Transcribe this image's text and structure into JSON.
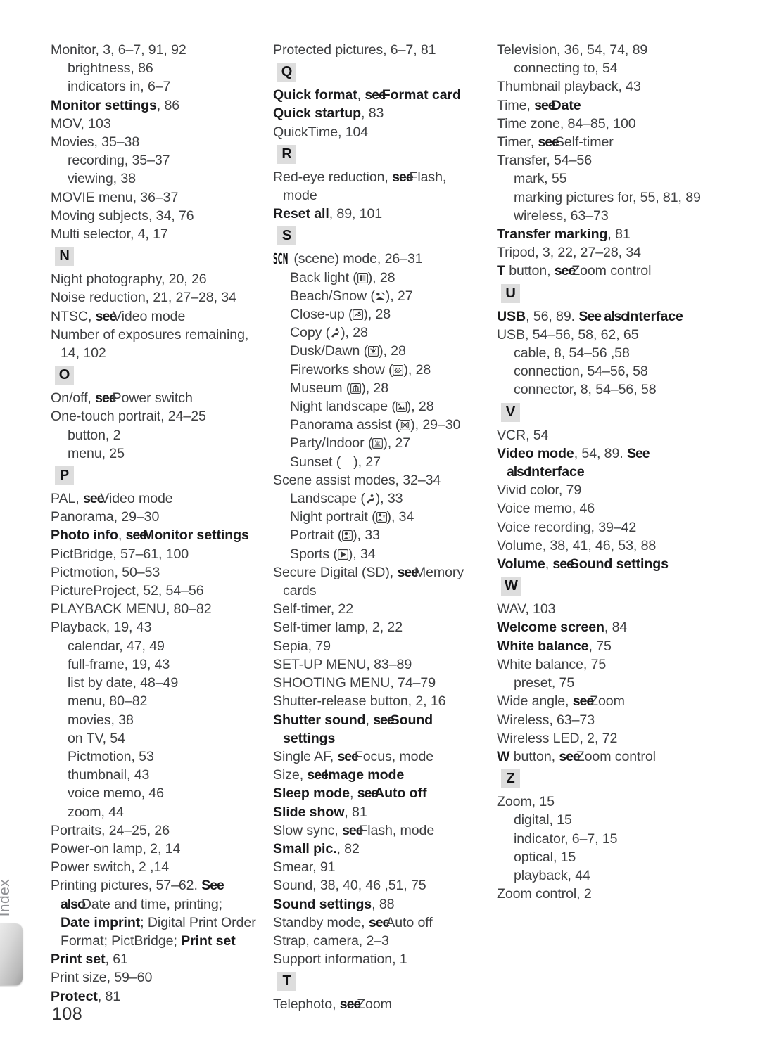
{
  "page": {
    "folio": "108",
    "tab_label": "Index"
  },
  "columns": [
    {
      "id": "column-1",
      "entries": [
        {
          "level": 1,
          "text": "Monitor, 3, 6–7, 91, 92"
        },
        {
          "level": 2,
          "text": "brightness, 86"
        },
        {
          "level": 2,
          "text": "indicators in, 6–7"
        },
        {
          "level": 1,
          "bold_head": "Monitor settings",
          "text": ", 86"
        },
        {
          "level": 1,
          "text": "MOV, 103"
        },
        {
          "level": 1,
          "text": "Movies, 35–38"
        },
        {
          "level": 2,
          "text": "recording, 35–37"
        },
        {
          "level": 2,
          "text": "viewing, 38"
        },
        {
          "level": 1,
          "text": "MOVIE menu, 36–37"
        },
        {
          "level": 1,
          "text": "Moving subjects, 34, 76"
        },
        {
          "level": 1,
          "text": "Multi selector, 4, 17"
        },
        {
          "letter": "N"
        },
        {
          "level": 1,
          "text": "Night photography, 20, 26"
        },
        {
          "level": 1,
          "text": "Noise reduction, 21, 27–28, 34"
        },
        {
          "level": 1,
          "pre": "NTSC, ",
          "see": "see",
          "post": "Video mode"
        },
        {
          "level": 1,
          "text": "Number of exposures remaining,"
        },
        {
          "level": 3,
          "text": "14, 102"
        },
        {
          "letter": "O"
        },
        {
          "level": 1,
          "pre": "On/off, ",
          "see": "see",
          "post": "Power switch"
        },
        {
          "level": 1,
          "text": "One-touch portrait, 24–25"
        },
        {
          "level": 2,
          "text": "button, 2"
        },
        {
          "level": 2,
          "text": "menu, 25"
        },
        {
          "letter": "P"
        },
        {
          "level": 1,
          "pre": "PAL, ",
          "see": "see",
          "post": "Video mode"
        },
        {
          "level": 1,
          "text": "Panorama, 29–30"
        },
        {
          "level": 1,
          "bold_head": "Photo info",
          "pre": ", ",
          "see": "see",
          "bold_post": "Monitor settings"
        },
        {
          "level": 1,
          "text": "PictBridge, 57–61, 100"
        },
        {
          "level": 1,
          "text": "Pictmotion, 50–53"
        },
        {
          "level": 1,
          "text": "PictureProject, 52, 54–56"
        },
        {
          "level": 1,
          "text": "PLAYBACK MENU, 80–82"
        },
        {
          "level": 1,
          "text": "Playback, 19, 43"
        },
        {
          "level": 2,
          "text": "calendar, 47, 49"
        },
        {
          "level": 2,
          "text": "full-frame, 19, 43"
        },
        {
          "level": 2,
          "text": "list by date, 48–49"
        },
        {
          "level": 2,
          "text": "menu, 80–82"
        },
        {
          "level": 2,
          "text": "movies, 38"
        },
        {
          "level": 2,
          "text": "on TV, 54"
        },
        {
          "level": 2,
          "text": "Pictmotion, 53"
        },
        {
          "level": 2,
          "text": "thumbnail, 43"
        },
        {
          "level": 2,
          "text": "voice memo, 46"
        },
        {
          "level": 2,
          "text": "zoom, 44"
        },
        {
          "level": 1,
          "text": "Portraits, 24–25, 26"
        },
        {
          "level": 1,
          "text": "Power-on lamp, 2, 14"
        },
        {
          "level": 1,
          "text": "Power switch, 2 ,14"
        },
        {
          "level": 1,
          "pre": "Printing pictures, 57–62. ",
          "see": "See"
        },
        {
          "level": 3,
          "see": "also",
          "post": "Date and time, printing;"
        },
        {
          "level": 3,
          "bold_head": "Date imprint",
          "post": "; Digital Print Order"
        },
        {
          "level": 3,
          "pre": "Format; PictBridge; ",
          "bold_tail": "Print set"
        },
        {
          "level": 1,
          "bold_head": "Print set",
          "text": ", 61"
        },
        {
          "level": 1,
          "text": "Print size, 59–60"
        },
        {
          "level": 1,
          "bold_head": "Protect",
          "text": ", 81"
        }
      ]
    },
    {
      "id": "column-2",
      "entries": [
        {
          "level": 1,
          "text": "Protected pictures, 6–7, 81"
        },
        {
          "letter": "Q"
        },
        {
          "level": 1,
          "bold_head": "Quick format",
          "pre": ", ",
          "see": "see",
          "bold_post": "Format card"
        },
        {
          "level": 1,
          "bold_head": "Quick startup",
          "text": ", 83"
        },
        {
          "level": 1,
          "text": "QuickTime, 104"
        },
        {
          "letter": "R"
        },
        {
          "level": 1,
          "pre": "Red-eye reduction, ",
          "see": "see",
          "post": "Flash,"
        },
        {
          "level": 3,
          "text": "mode"
        },
        {
          "level": 1,
          "bold_head": "Reset all",
          "text": ", 89, 101"
        },
        {
          "letter": "S"
        },
        {
          "level": 1,
          "scn": true,
          "text": " (scene) mode, 26–31"
        },
        {
          "level": 2,
          "pre": "Back light (",
          "icon": "backlight-icon",
          "post": "), 28"
        },
        {
          "level": 2,
          "pre": "Beach/Snow (",
          "icon": "beach-snow-icon",
          "post": "), 27"
        },
        {
          "level": 2,
          "pre": "Close-up (",
          "icon": "close-up-icon",
          "post": "), 28"
        },
        {
          "level": 2,
          "pre": "Copy (",
          "icon": "copy-icon",
          "post": "), 28"
        },
        {
          "level": 2,
          "pre": "Dusk/Dawn (",
          "icon": "dusk-dawn-icon",
          "post": "), 28"
        },
        {
          "level": 2,
          "pre": "Fireworks show (",
          "icon": "fireworks-icon",
          "post": "), 28"
        },
        {
          "level": 2,
          "pre": "Museum (",
          "icon": "museum-icon",
          "post": "), 28"
        },
        {
          "level": 2,
          "pre": "Night landscape (",
          "icon": "night-landscape-icon",
          "post": "), 28"
        },
        {
          "level": 2,
          "pre": "Panorama assist (",
          "icon": "panorama-assist-icon",
          "post": "), 29–30"
        },
        {
          "level": 2,
          "pre": "Party/Indoor (",
          "icon": "party-indoor-icon",
          "post": "), 27"
        },
        {
          "level": 2,
          "pre": "Sunset (",
          "icon": "missing-icon",
          "post": "), 27"
        },
        {
          "level": 1,
          "text": "Scene assist modes, 32–34"
        },
        {
          "level": 2,
          "pre": "Landscape (",
          "icon": "landscape-icon",
          "post": "), 33"
        },
        {
          "level": 2,
          "pre": "Night portrait (",
          "icon": "night-portrait-icon",
          "post": "), 34"
        },
        {
          "level": 2,
          "pre": "Portrait (",
          "icon": "portrait-icon",
          "post": "), 33"
        },
        {
          "level": 2,
          "pre": "Sports (",
          "icon": "sports-icon",
          "post": "), 34"
        },
        {
          "level": 1,
          "pre": "Secure Digital (SD), ",
          "see": "see",
          "post": "Memory"
        },
        {
          "level": 3,
          "text": "cards"
        },
        {
          "level": 1,
          "text": "Self-timer, 22"
        },
        {
          "level": 1,
          "text": "Self-timer lamp, 2, 22"
        },
        {
          "level": 1,
          "text": "Sepia, 79"
        },
        {
          "level": 1,
          "text": "SET-UP MENU, 83–89"
        },
        {
          "level": 1,
          "text": "SHOOTING MENU, 74–79"
        },
        {
          "level": 1,
          "text": "Shutter-release button, 2, 16"
        },
        {
          "level": 1,
          "bold_head": "Shutter sound",
          "pre": ", ",
          "see": "see",
          "bold_post": "Sound"
        },
        {
          "level": 3,
          "bold_tail": "settings"
        },
        {
          "level": 1,
          "pre": "Single AF, ",
          "see": "see",
          "post": "Focus, mode"
        },
        {
          "level": 1,
          "pre": "Size, ",
          "see": "see",
          "bold_post": "Image mode"
        },
        {
          "level": 1,
          "bold_head": "Sleep mode",
          "pre": ", ",
          "see": "see",
          "bold_post": "Auto off"
        },
        {
          "level": 1,
          "bold_head": "Slide show",
          "text": ", 81"
        },
        {
          "level": 1,
          "pre": "Slow sync, ",
          "see": "see",
          "post": "Flash, mode"
        },
        {
          "level": 1,
          "bold_head": "Small pic.",
          "text": ", 82"
        },
        {
          "level": 1,
          "text": "Smear, 91"
        },
        {
          "level": 1,
          "text": "Sound, 38, 40, 46 ,51, 75"
        },
        {
          "level": 1,
          "bold_head": "Sound settings",
          "text": ", 88"
        },
        {
          "level": 1,
          "pre": "Standby mode, ",
          "see": "see",
          "post": "Auto off"
        },
        {
          "level": 1,
          "text": "Strap, camera, 2–3"
        },
        {
          "level": 1,
          "text": "Support information, 1"
        },
        {
          "letter": "T"
        },
        {
          "level": 1,
          "pre": "Telephoto, ",
          "see": "see",
          "post": "Zoom"
        }
      ]
    },
    {
      "id": "column-3",
      "entries": [
        {
          "level": 1,
          "text": "Television, 36, 54, 74, 89"
        },
        {
          "level": 2,
          "text": "connecting to, 54"
        },
        {
          "level": 1,
          "text": "Thumbnail playback, 43"
        },
        {
          "level": 1,
          "pre": "Time, ",
          "see": "see",
          "bold_post": "Date"
        },
        {
          "level": 1,
          "text": "Time zone, 84–85, 100"
        },
        {
          "level": 1,
          "pre": "Timer, ",
          "see": "see",
          "post": "Self-timer"
        },
        {
          "level": 1,
          "text": "Transfer, 54–56"
        },
        {
          "level": 2,
          "text": "mark, 55"
        },
        {
          "level": 2,
          "text": "marking pictures for, 55, 81, 89"
        },
        {
          "level": 2,
          "text": "wireless, 63–73"
        },
        {
          "level": 1,
          "bold_head": "Transfer marking",
          "text": ", 81"
        },
        {
          "level": 1,
          "text": "Tripod, 3, 22, 27–28, 34"
        },
        {
          "level": 1,
          "bold_head": "T",
          "pre": " button, ",
          "see": "see",
          "post": "Zoom control"
        },
        {
          "letter": "U"
        },
        {
          "level": 1,
          "bold_head": "USB",
          "pre": ", 56, 89.  ",
          "see": "See also",
          "bold_post": "Interface"
        },
        {
          "level": 1,
          "text": "USB, 54–56, 58, 62, 65"
        },
        {
          "level": 2,
          "text": "cable, 8, 54–56 ,58"
        },
        {
          "level": 2,
          "text": "connection, 54–56, 58"
        },
        {
          "level": 2,
          "text": "connector, 8, 54–56, 58"
        },
        {
          "letter": "V"
        },
        {
          "level": 1,
          "text": "VCR, 54"
        },
        {
          "level": 1,
          "bold_head": "Video mode",
          "pre": ", 54, 89.  ",
          "see": "See"
        },
        {
          "level": 3,
          "see": "also",
          "bold_post": "Interface"
        },
        {
          "level": 1,
          "text": "Vivid color, 79"
        },
        {
          "level": 1,
          "text": "Voice memo, 46"
        },
        {
          "level": 1,
          "text": "Voice recording, 39–42"
        },
        {
          "level": 1,
          "text": "Volume, 38, 41, 46, 53, 88"
        },
        {
          "level": 1,
          "bold_head": "Volume",
          "pre": ", ",
          "see": "see",
          "bold_post": "Sound settings"
        },
        {
          "letter": "W"
        },
        {
          "level": 1,
          "text": "WAV, 103"
        },
        {
          "level": 1,
          "bold_head": "Welcome screen",
          "text": ", 84"
        },
        {
          "level": 1,
          "bold_head": "White balance",
          "text": ", 75"
        },
        {
          "level": 1,
          "text": "White balance, 75"
        },
        {
          "level": 2,
          "text": "preset, 75"
        },
        {
          "level": 1,
          "pre": "Wide angle, ",
          "see": "see",
          "post": "Zoom"
        },
        {
          "level": 1,
          "text": "Wireless, 63–73"
        },
        {
          "level": 1,
          "text": "Wireless LED, 2, 72"
        },
        {
          "level": 1,
          "bold_head": "W",
          "pre": " button, ",
          "see": "see",
          "post": "Zoom control"
        },
        {
          "letter": "Z"
        },
        {
          "level": 1,
          "text": "Zoom, 15"
        },
        {
          "level": 2,
          "text": "digital, 15"
        },
        {
          "level": 2,
          "text": "indicator, 6–7, 15"
        },
        {
          "level": 2,
          "text": "optical, 15"
        },
        {
          "level": 2,
          "text": "playback, 44"
        },
        {
          "level": 1,
          "text": "Zoom control, 2"
        }
      ]
    }
  ]
}
